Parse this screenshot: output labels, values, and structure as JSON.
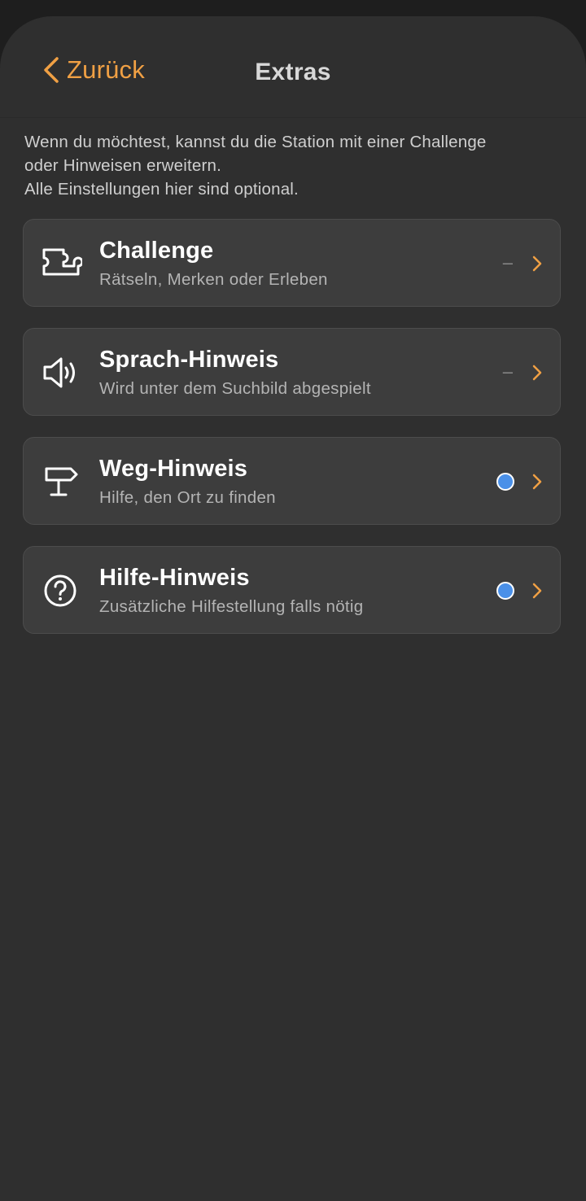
{
  "header": {
    "back_label": "Zurück",
    "title": "Extras"
  },
  "intro": {
    "lines": [
      "Wenn du möchtest, kannst du die Station mit einer Challenge",
      "oder Hinweisen erweitern.",
      "Alle Einstellungen hier sind optional."
    ]
  },
  "items": [
    {
      "title": "Challenge",
      "subtitle": "Rätseln, Merken oder Erleben",
      "icon": "puzzle-icon",
      "status": "–"
    },
    {
      "title": "Sprach-Hinweis",
      "subtitle": "Wird unter dem Suchbild abgespielt",
      "icon": "speaker-icon",
      "status": "–"
    },
    {
      "title": "Weg-Hinweis",
      "subtitle": "Hilfe, den Ort zu finden",
      "icon": "signpost-icon",
      "status": "dot"
    },
    {
      "title": "Hilfe-Hinweis",
      "subtitle": "Zusätzliche Hilfestellung falls nötig",
      "icon": "question-circle-icon",
      "status": "dot"
    }
  ],
  "colors": {
    "accent": "#f0a044",
    "status_dot": "#4a90e8",
    "background": "#2f2f2f",
    "card": "#3d3d3d"
  }
}
